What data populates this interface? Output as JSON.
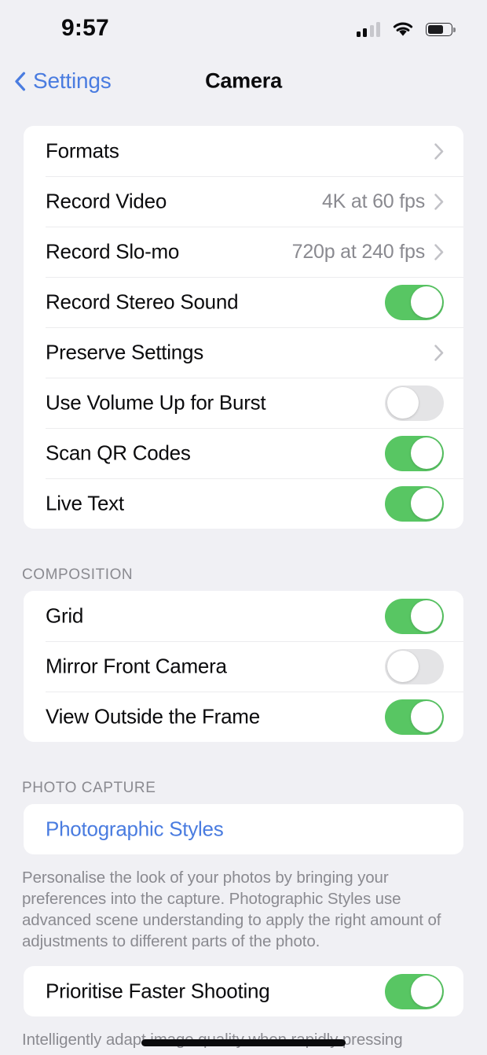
{
  "status_bar": {
    "time": "9:57",
    "cellular_icon": "cellular-signal-icon",
    "cellular_bars_filled": 2,
    "cellular_bars_total": 4,
    "wifi_icon": "wifi-icon",
    "battery_icon": "battery-icon",
    "battery_level_percent": 65
  },
  "nav": {
    "back_icon": "chevron-left-icon",
    "back_label": "Settings",
    "title": "Camera"
  },
  "colors": {
    "accent_blue": "#4a7ce0",
    "toggle_on_green": "#58c663",
    "toggle_off_gray": "#e4e4e6",
    "page_background": "#f0f0f4",
    "card_background": "#ffffff",
    "secondary_text": "#8a8a90"
  },
  "sections": [
    {
      "header": "",
      "footer": "",
      "rows": [
        {
          "label": "Formats",
          "type": "disclosure",
          "value": "",
          "icon": "chevron-right-icon"
        },
        {
          "label": "Record Video",
          "type": "disclosure",
          "value": "4K at 60 fps",
          "icon": "chevron-right-icon"
        },
        {
          "label": "Record Slo-mo",
          "type": "disclosure",
          "value": "720p at 240 fps",
          "icon": "chevron-right-icon"
        },
        {
          "label": "Record Stereo Sound",
          "type": "toggle",
          "value": "on"
        },
        {
          "label": "Preserve Settings",
          "type": "disclosure",
          "value": "",
          "icon": "chevron-right-icon"
        },
        {
          "label": "Use Volume Up for Burst",
          "type": "toggle",
          "value": "off"
        },
        {
          "label": "Scan QR Codes",
          "type": "toggle",
          "value": "on"
        },
        {
          "label": "Live Text",
          "type": "toggle",
          "value": "on"
        }
      ]
    },
    {
      "header": "COMPOSITION",
      "footer": "",
      "rows": [
        {
          "label": "Grid",
          "type": "toggle",
          "value": "on"
        },
        {
          "label": "Mirror Front Camera",
          "type": "toggle",
          "value": "off"
        },
        {
          "label": "View Outside the Frame",
          "type": "toggle",
          "value": "on"
        }
      ]
    },
    {
      "header": "PHOTO CAPTURE",
      "footer": "Personalise the look of your photos by bringing your preferences into the capture. Photographic Styles use advanced scene understanding to apply the right amount of adjustments to different parts of the photo.",
      "rows": [
        {
          "label": "Photographic Styles",
          "type": "link",
          "value": ""
        }
      ]
    },
    {
      "header": "",
      "footer": "Intelligently adapt image quality when rapidly pressing",
      "rows": [
        {
          "label": "Prioritise Faster Shooting",
          "type": "toggle",
          "value": "on"
        }
      ]
    }
  ],
  "home_indicator": "home-indicator"
}
